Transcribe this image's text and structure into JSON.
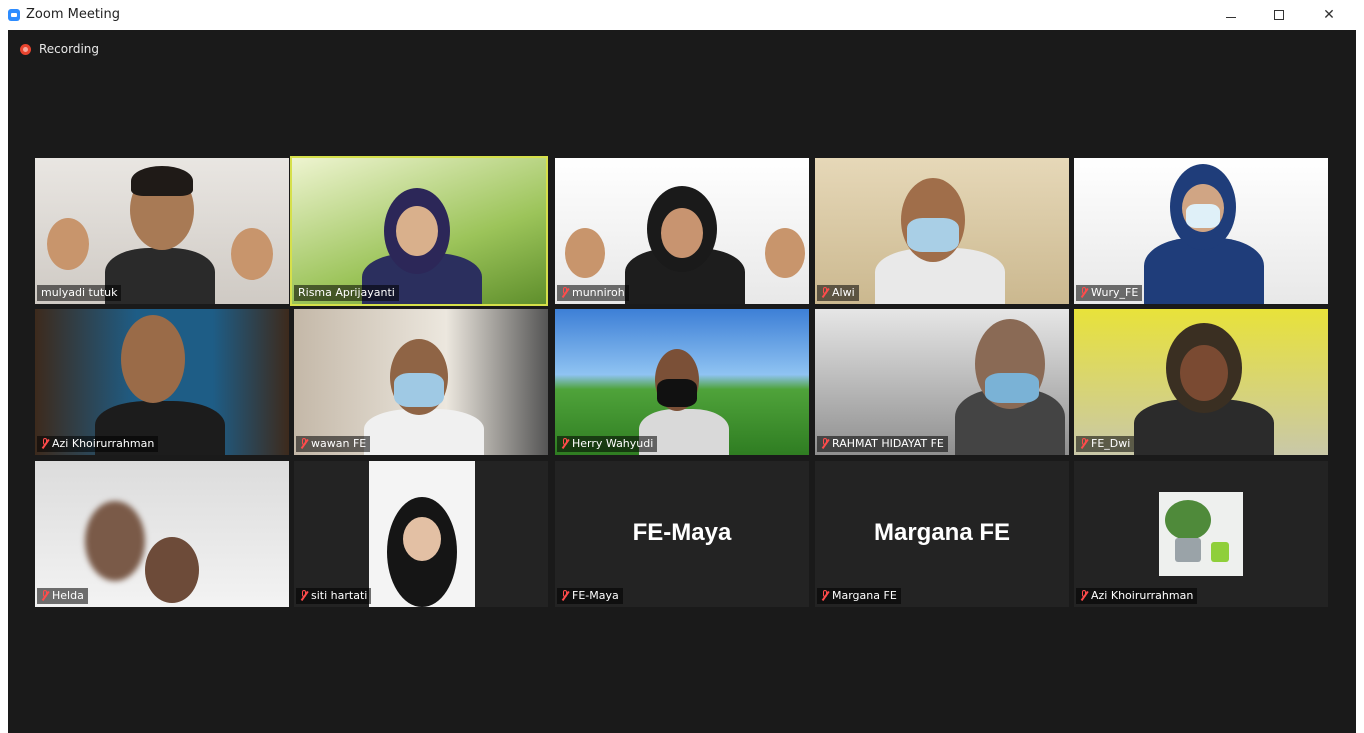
{
  "window": {
    "title": "Zoom Meeting",
    "controls": [
      "minimize",
      "maximize",
      "close"
    ]
  },
  "recording": {
    "label": "Recording"
  },
  "tiles": [
    {
      "name": "mulyadi tutuk",
      "muted": false,
      "active": false
    },
    {
      "name": "Risma Aprijayanti",
      "muted": false,
      "active": true
    },
    {
      "name": "munniroh",
      "muted": true,
      "active": false
    },
    {
      "name": "Alwi",
      "muted": true,
      "active": false
    },
    {
      "name": "Wury_FE",
      "muted": true,
      "active": false
    },
    {
      "name": "Azi Khoirurrahman",
      "muted": true,
      "active": false
    },
    {
      "name": "wawan FE",
      "muted": true,
      "active": false
    },
    {
      "name": "Herry Wahyudi",
      "muted": true,
      "active": false
    },
    {
      "name": "RAHMAT HIDAYAT FE",
      "muted": true,
      "active": false
    },
    {
      "name": "FE_Dwi",
      "muted": true,
      "active": false
    },
    {
      "name": "Helda",
      "muted": true,
      "active": false
    },
    {
      "name": "siti hartati",
      "muted": true,
      "active": false
    },
    {
      "name": "FE-Maya",
      "muted": true,
      "active": false,
      "center_name": "FE-Maya"
    },
    {
      "name": "Margana FE",
      "muted": true,
      "active": false,
      "center_name": "Margana FE"
    },
    {
      "name": "Azi Khoirurrahman",
      "muted": true,
      "active": false
    }
  ],
  "colors": {
    "meeting_bg": "#1a1a1a",
    "active_speaker_border": "#d6e04a",
    "muted_icon": "#ff4b4b",
    "recording_dot": "#e8442e"
  }
}
